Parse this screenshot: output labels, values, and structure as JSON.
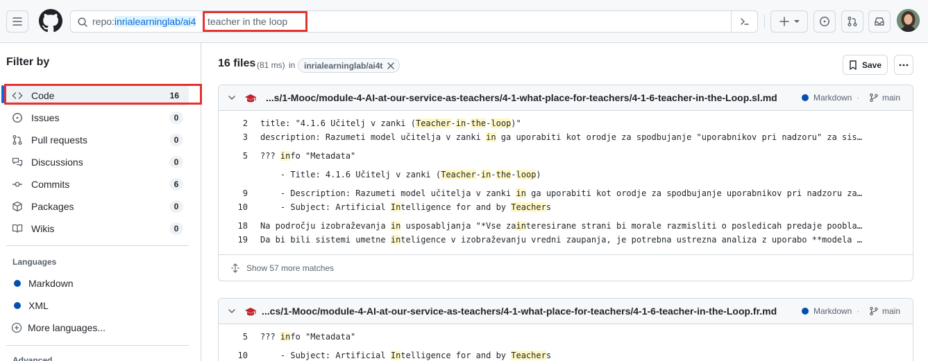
{
  "header": {
    "search_prefix": "repo:",
    "search_repo": "inrialearninglab/ai4",
    "search_query": "teacher in the loop"
  },
  "sidebar": {
    "title": "Filter by",
    "items": [
      {
        "label": "Code",
        "count": "16"
      },
      {
        "label": "Issues",
        "count": "0"
      },
      {
        "label": "Pull requests",
        "count": "0"
      },
      {
        "label": "Discussions",
        "count": "0"
      },
      {
        "label": "Commits",
        "count": "6"
      },
      {
        "label": "Packages",
        "count": "0"
      },
      {
        "label": "Wikis",
        "count": "0"
      }
    ],
    "languages_title": "Languages",
    "languages": [
      {
        "label": "Markdown",
        "color": "#0550ae"
      },
      {
        "label": "XML",
        "color": "#0550ae"
      }
    ],
    "more_languages": "More languages...",
    "advanced_title": "Advanced"
  },
  "results": {
    "title": "16 files",
    "time": "(81 ms)",
    "in_label": "in",
    "repo_chip": "inrialearninglab/ai4t",
    "save_label": "Save"
  },
  "cards": [
    {
      "path": "...s/1-Mooc/module-4-AI-at-our-service-as-teachers/4-1-what-place-for-teachers/4-1-6-teacher-in-the-Loop.sl.md",
      "language": "Markdown",
      "branch": "main",
      "lines": [
        {
          "n": "2",
          "html": "title: \"4.1.6 Učitelj v zanki (<mark>Teacher</mark>-<mark>in</mark>-<mark>the</mark>-<mark>loop</mark>)\""
        },
        {
          "n": "3",
          "html": "description: Razumeti model učitelja v zanki <mark>in</mark> ga uporabiti kot orodje za spodbujanje \"uporabnikov pri nadzoru\" za sistem..."
        },
        {
          "n": "5",
          "html": "??? <mark>in</mark>fo \"Metadata\""
        },
        {
          "n": "",
          "html": "    - Title: 4.1.6 Učitelj v zanki (<mark>Teacher</mark>-<mark>in</mark>-<mark>the</mark>-<mark>loop</mark>)"
        },
        {
          "n": "9",
          "html": "    - Description: Razumeti model učitelja v zanki <mark>in</mark> ga uporabiti kot orodje za spodbujanje uporabnikov pri nadzoru za..."
        },
        {
          "n": "10",
          "html": "    - Subject: Artificial <mark>In</mark>telligence for and by <mark>Teacher</mark>s"
        },
        {
          "n": "18",
          "html": "Na področju izobraževanja <mark>in</mark> usposabljanja \"*Vse za<mark>in</mark>teresirane strani bi morale razmisliti o posledicah predaje poobla..."
        },
        {
          "n": "19",
          "html": "Da bi bili sistemi umetne <mark>in</mark>teligence v izobraževanju vredni zaupanja, je potrebna ustrezna analiza z uporabo **modela ..."
        }
      ],
      "more": "Show 57 more matches"
    },
    {
      "path": "...cs/1-Mooc/module-4-AI-at-our-service-as-teachers/4-1-what-place-for-teachers/4-1-6-teacher-in-the-Loop.fr.md",
      "language": "Markdown",
      "branch": "main",
      "lines": [
        {
          "n": "5",
          "html": "??? <mark>in</mark>fo \"Metadata\""
        },
        {
          "n": "10",
          "html": "    - Subject: Artificial <mark>In</mark>telligence for and by <mark>Teacher</mark>s"
        }
      ]
    }
  ]
}
